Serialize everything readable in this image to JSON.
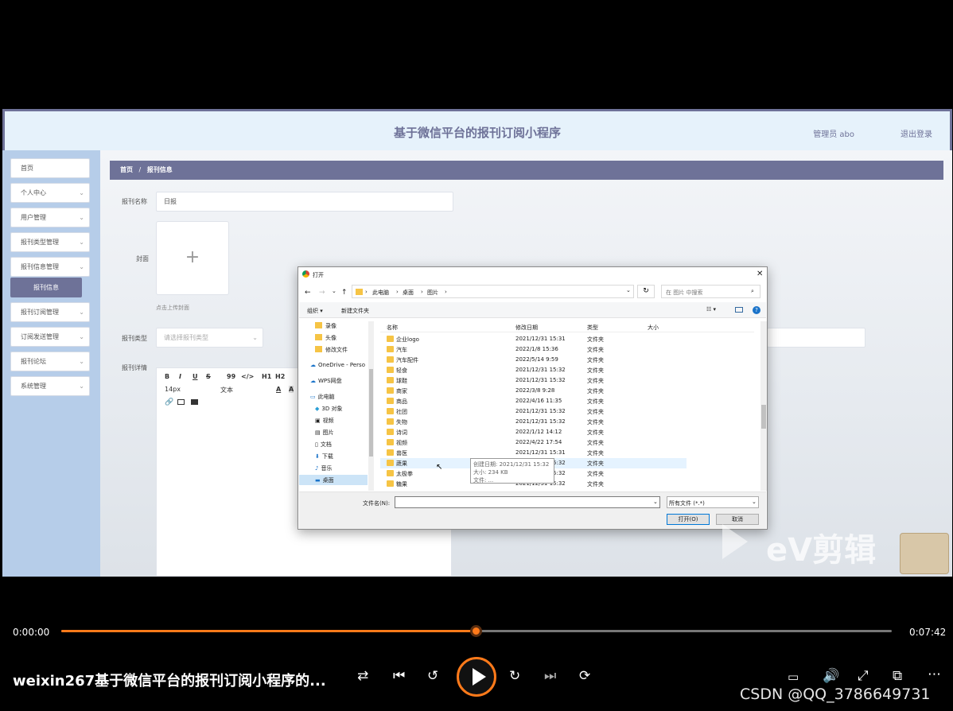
{
  "app": {
    "title": "基于微信平台的报刊订阅小程序",
    "user": "管理员 abo",
    "logout": "退出登录"
  },
  "sidebar": {
    "items": [
      {
        "label": "首页"
      },
      {
        "label": "个人中心"
      },
      {
        "label": "用户管理"
      },
      {
        "label": "报刊类型管理"
      },
      {
        "label": "报刊信息管理"
      },
      {
        "label": "报刊订阅管理"
      },
      {
        "label": "订阅发送管理"
      },
      {
        "label": "报刊论坛"
      },
      {
        "label": "系统管理"
      }
    ],
    "active_sub": "报刊信息",
    "chevron": "⌄"
  },
  "breadcrumb": {
    "home": "首页",
    "sep": "/",
    "current": "报刊信息"
  },
  "form": {
    "name_label": "报刊名称",
    "name_value": "日报",
    "cover_label": "封面",
    "cover_plus": "+",
    "cover_hint": "点击上传封面",
    "type_label": "报刊类型",
    "type_placeholder": "请选择报刊类型",
    "detail_label": "报刊详情",
    "toolbar": {
      "bold": "B",
      "italic": "I",
      "underline": "U",
      "strike": "S",
      "quote": "99",
      "code": "</>",
      "h1": "H1",
      "h2": "H2",
      "size": "14px",
      "text": "文本",
      "color": "A",
      "bg": "A"
    }
  },
  "dialog": {
    "title": "打开",
    "path": [
      "此电脑",
      "桌面",
      "图片"
    ],
    "search_placeholder": "在 图片 中搜索",
    "organize": "组织 ▾",
    "new_folder": "新建文件夹",
    "columns": {
      "name": "名称",
      "date": "修改日期",
      "type": "类型",
      "size": "大小"
    },
    "nav": [
      {
        "label": "录像",
        "icon": "folder"
      },
      {
        "label": "头像",
        "icon": "folder"
      },
      {
        "label": "修改文件",
        "icon": "folder"
      },
      {
        "label": "OneDrive - Perso",
        "icon": "cloud"
      },
      {
        "label": "WPS网盘",
        "icon": "cloud"
      },
      {
        "label": "此电脑",
        "icon": "pc"
      },
      {
        "label": "3D 对象",
        "icon": "cube"
      },
      {
        "label": "视频",
        "icon": "video"
      },
      {
        "label": "图片",
        "icon": "image"
      },
      {
        "label": "文档",
        "icon": "doc"
      },
      {
        "label": "下载",
        "icon": "download"
      },
      {
        "label": "音乐",
        "icon": "music"
      },
      {
        "label": "桌面",
        "icon": "desktop"
      }
    ],
    "files": [
      {
        "name": "企业logo",
        "date": "2021/12/31 15:31",
        "type": "文件夹"
      },
      {
        "name": "汽车",
        "date": "2022/1/8 15:36",
        "type": "文件夹"
      },
      {
        "name": "汽车配件",
        "date": "2022/5/14 9:59",
        "type": "文件夹"
      },
      {
        "name": "轻食",
        "date": "2021/12/31 15:32",
        "type": "文件夹"
      },
      {
        "name": "球鞋",
        "date": "2021/12/31 15:32",
        "type": "文件夹"
      },
      {
        "name": "商家",
        "date": "2022/3/8 9:28",
        "type": "文件夹"
      },
      {
        "name": "商品",
        "date": "2022/4/16 11:35",
        "type": "文件夹"
      },
      {
        "name": "社团",
        "date": "2021/12/31 15:32",
        "type": "文件夹"
      },
      {
        "name": "失物",
        "date": "2021/12/31 15:32",
        "type": "文件夹"
      },
      {
        "name": "诗词",
        "date": "2022/1/12 14:12",
        "type": "文件夹"
      },
      {
        "name": "视频",
        "date": "2022/4/22 17:54",
        "type": "文件夹"
      },
      {
        "name": "兽医",
        "date": "2021/12/31 15:31",
        "type": "文件夹"
      },
      {
        "name": "蔬果",
        "date": "2021/12/31 15:32",
        "type": "文件夹"
      },
      {
        "name": "太极拳",
        "date": "2021/12/31 15:32",
        "type": "文件夹"
      },
      {
        "name": "糖果",
        "date": "2021/12/31 15:32",
        "type": "文件夹"
      }
    ],
    "tooltip": {
      "created": "创建日期: 2021/12/31 15:32",
      "size": "大小: 234 KB",
      "files": "文件: ..."
    },
    "filename_label": "文件名(N):",
    "filter": "所有文件 (*.*)",
    "open": "打开(O)",
    "cancel": "取消"
  },
  "player": {
    "time_current": "0:00:00",
    "time_total": "0:07:42",
    "progress": 0.5,
    "video_title": "weixin267基于微信平台的报刊订阅小程序的...",
    "watermark": "CSDN @QQ_3786649731",
    "editor_brand": "eV剪辑"
  }
}
